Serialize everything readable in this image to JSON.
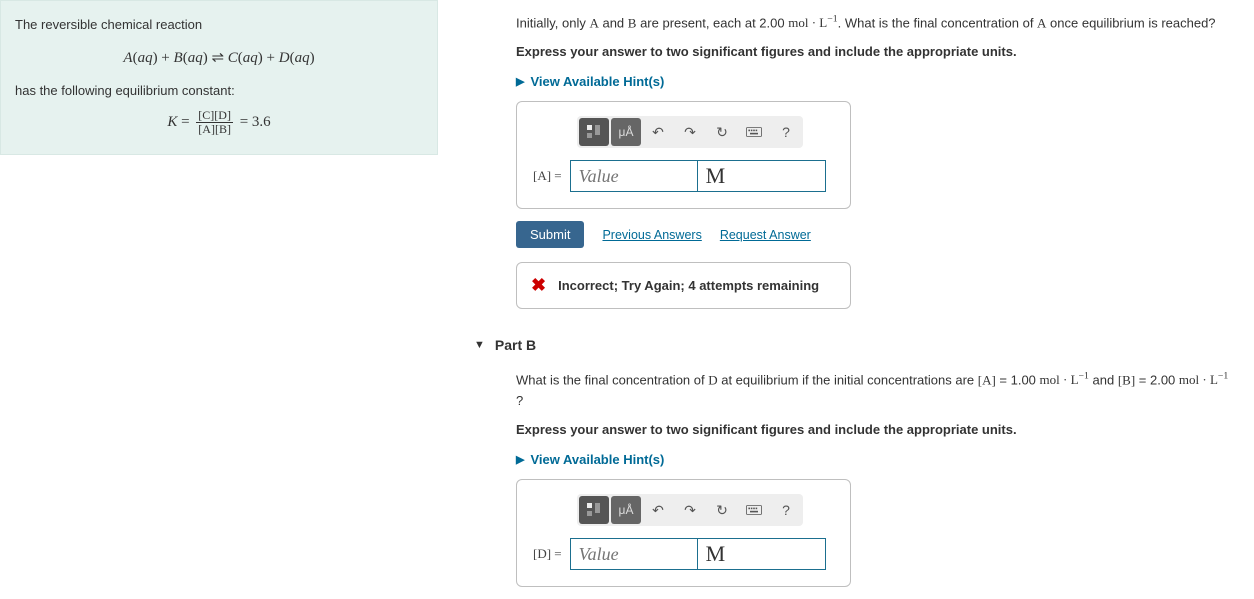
{
  "intro": {
    "line1": "The reversible chemical reaction",
    "reaction": "A(aq) + B(aq) ⇌ C(aq) + D(aq)",
    "line2": "has the following equilibrium constant:",
    "k_value": "3.6"
  },
  "partA": {
    "question_pre": "Initially, only ",
    "question_mid1": " and ",
    "question_mid2": " are present, each at 2.00 ",
    "question_post": ". What is the final concentration of ",
    "question_end": " once equilibrium is reached?",
    "species_A": "A",
    "species_B": "B",
    "unit_mol": "mol · L",
    "instruction": "Express your answer to two significant figures and include the appropriate units.",
    "hint_label": "View Available Hint(s)",
    "input_label": "[A] =",
    "value_placeholder": "Value",
    "unit_value": "M",
    "submit": "Submit",
    "prev_answers": "Previous Answers",
    "request_answer": "Request Answer",
    "feedback": "Incorrect; Try Again; 4 attempts remaining"
  },
  "partB": {
    "header": "Part B",
    "q_pre": "What is the final concentration of ",
    "species_D": "D",
    "q_mid": " at equilibrium if the initial concentrations are ",
    "concA_label": "[A]",
    "concA_val": " = 1.00 ",
    "concB_label": "[B]",
    "concB_val": " = 2.00 ",
    "unit_mol": "mol · L",
    "q_and": " and ",
    "q_end": " ?",
    "instruction": "Express your answer to two significant figures and include the appropriate units.",
    "hint_label": "View Available Hint(s)",
    "input_label": "[D] =",
    "value_placeholder": "Value",
    "unit_value": "M"
  },
  "toolbar": {
    "units_label": "μÅ",
    "help_label": "?"
  }
}
